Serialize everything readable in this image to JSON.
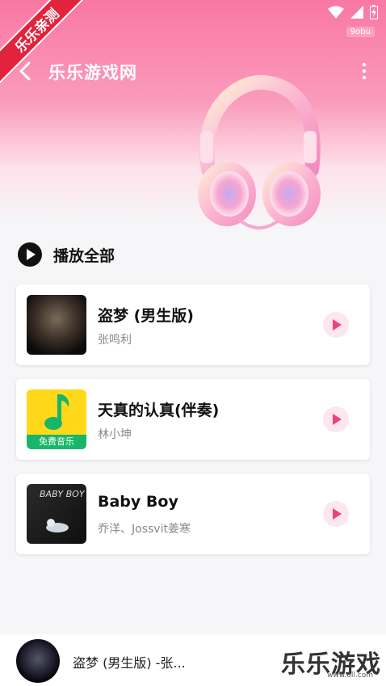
{
  "corner_ribbon": "乐乐亲测",
  "status_tag": "9obu",
  "header": {
    "title": "乐乐游戏网"
  },
  "play_all_label": "播放全部",
  "songs": [
    {
      "title": "盗梦 (男生版)",
      "artist": "张鸣利"
    },
    {
      "title": "天真的认真(伴奏)",
      "artist": "林小坤",
      "cover_badge": "免费音乐"
    },
    {
      "title": "Baby Boy",
      "artist": "乔洋、Jossvit姜寒",
      "cover_text": "BABY BOY"
    }
  ],
  "player": {
    "now_playing": "盗梦 (男生版) -张..."
  },
  "watermark": {
    "text": "乐乐游戏",
    "url": "www.6ll.com"
  },
  "colors": {
    "accent": "#f0407a",
    "hero_top": "#f978a3",
    "ribbon": "#e2233c"
  }
}
